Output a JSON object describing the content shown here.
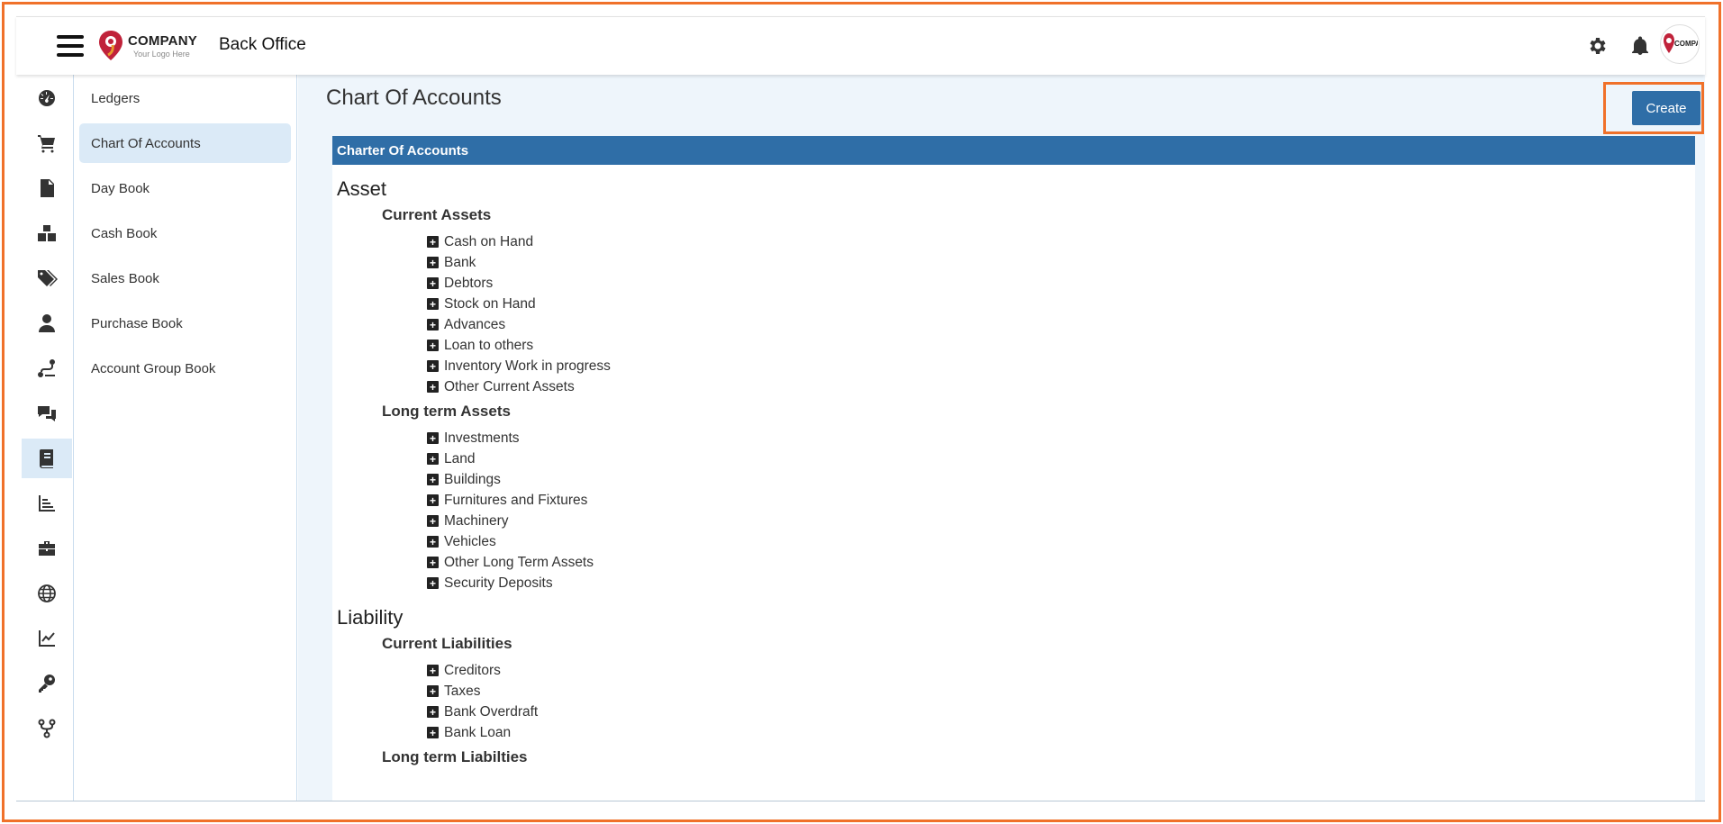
{
  "header": {
    "logo_name": "COMPANY",
    "logo_tagline": "Your Logo Here",
    "app_title": "Back Office",
    "icons": [
      "menu-icon",
      "gear-icon",
      "bell-icon",
      "avatar"
    ],
    "avatar_text": "COMPANY"
  },
  "rail": {
    "items": [
      {
        "icon": "dashboard-icon"
      },
      {
        "icon": "cart-icon"
      },
      {
        "icon": "invoice-icon"
      },
      {
        "icon": "boxes-icon"
      },
      {
        "icon": "tags-icon"
      },
      {
        "icon": "user-icon"
      },
      {
        "icon": "route-icon"
      },
      {
        "icon": "chat-icon"
      },
      {
        "icon": "book-icon",
        "active": true
      },
      {
        "icon": "bar-chart-icon"
      },
      {
        "icon": "toolbox-icon"
      },
      {
        "icon": "globe-icon"
      },
      {
        "icon": "line-chart-icon"
      },
      {
        "icon": "key-icon"
      },
      {
        "icon": "fork-icon"
      }
    ]
  },
  "subnav": {
    "items": [
      {
        "label": "Ledgers"
      },
      {
        "label": "Chart Of Accounts",
        "active": true
      },
      {
        "label": "Day Book"
      },
      {
        "label": "Cash Book"
      },
      {
        "label": "Sales Book"
      },
      {
        "label": "Purchase Book"
      },
      {
        "label": "Account Group Book"
      }
    ]
  },
  "main": {
    "title": "Chart Of Accounts",
    "create_label": "Create",
    "panel_title": "Charter Of Accounts",
    "groups": [
      {
        "title": "Asset",
        "subgroups": [
          {
            "title": "Current Assets",
            "items": [
              "Cash on Hand",
              "Bank",
              "Debtors",
              "Stock on Hand",
              "Advances",
              "Loan to others",
              "Inventory Work in progress",
              "Other Current Assets"
            ]
          },
          {
            "title": "Long term Assets",
            "items": [
              "Investments",
              "Land",
              "Buildings",
              "Furnitures and Fixtures",
              "Machinery",
              "Vehicles",
              "Other Long Term Assets",
              "Security Deposits"
            ]
          }
        ]
      },
      {
        "title": "Liability",
        "subgroups": [
          {
            "title": "Current Liabilities",
            "items": [
              "Creditors",
              "Taxes",
              "Bank Overdraft",
              "Bank Loan"
            ]
          },
          {
            "title": "Long term Liabilties",
            "items": []
          }
        ]
      }
    ]
  },
  "colors": {
    "accent": "#2f6ea7",
    "highlight": "#f0712a",
    "active_bg": "#dbeaf7",
    "main_bg": "#eef5fb"
  }
}
